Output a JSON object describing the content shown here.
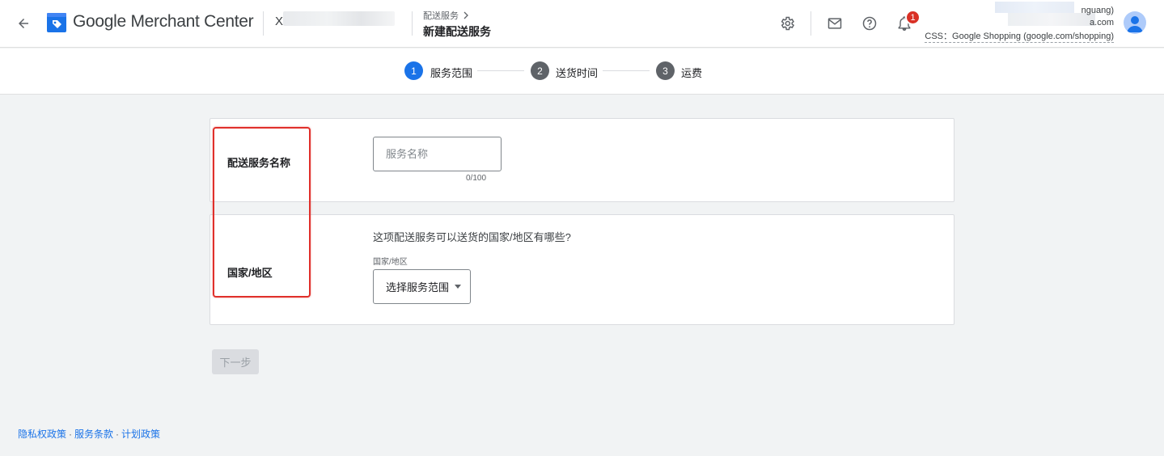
{
  "header": {
    "brand": "Google Merchant Center",
    "account_name_prefix": "Xi",
    "breadcrumb": "配送服务",
    "page_title": "新建配送服务",
    "notification_count": "1",
    "account_line1": "nguang)",
    "account_line2": "a.com",
    "css_line": "CSS：Google Shopping (google.com/shopping)"
  },
  "stepper": {
    "steps": [
      {
        "number": "1",
        "label": "服务范围",
        "active": true
      },
      {
        "number": "2",
        "label": "送货时间",
        "active": false
      },
      {
        "number": "3",
        "label": "运费",
        "active": false
      }
    ]
  },
  "service_name_card": {
    "label": "配送服务名称",
    "placeholder": "服务名称",
    "counter": "0/100"
  },
  "country_card": {
    "label": "国家/地区",
    "question": "这项配送服务可以送货的国家/地区有哪些?",
    "select_caption": "国家/地区",
    "select_value": "选择服务范围"
  },
  "next_button": "下一步",
  "footer": {
    "links": [
      "隐私权政策",
      "服务条款",
      "计划政策"
    ],
    "separator": "·"
  },
  "colors": {
    "accent": "#1a73e8",
    "highlight_border": "#e0302b",
    "inactive_step": "#5f6368"
  }
}
